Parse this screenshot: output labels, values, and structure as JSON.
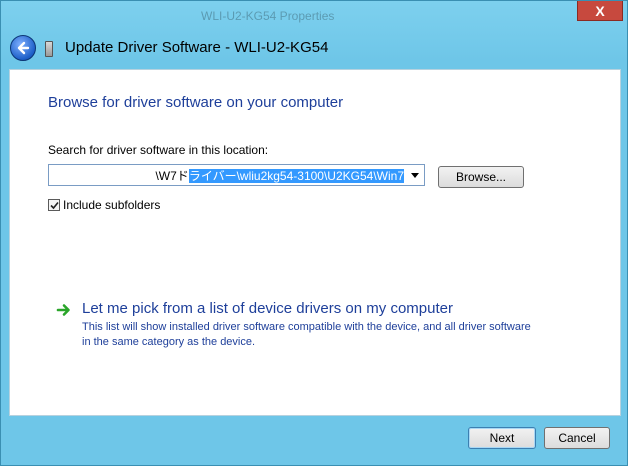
{
  "window": {
    "background_title": "WLI-U2-KG54 Properties",
    "title": "Update Driver Software - WLI-U2-KG54",
    "close_glyph": "X"
  },
  "main": {
    "heading": "Browse for driver software on your computer",
    "search_label": "Search for driver software in this location:",
    "path_unselected": "\\W7ド",
    "path_selected": "ライバー\\wliu2kg54-3100\\U2KG54\\Win7",
    "browse_label": "Browse...",
    "include_subfolders_label": "Include subfolders",
    "include_subfolders_checked": true,
    "pick_title": "Let me pick from a list of device drivers on my computer",
    "pick_description": "This list will show installed driver software compatible with the device, and all driver software in the same category as the device."
  },
  "footer": {
    "next_label": "Next",
    "cancel_label": "Cancel"
  },
  "colors": {
    "link_blue": "#1e3f9a",
    "selection": "#3399ff",
    "frame": "#6ec6e8",
    "arrow_green": "#2aa52a"
  }
}
